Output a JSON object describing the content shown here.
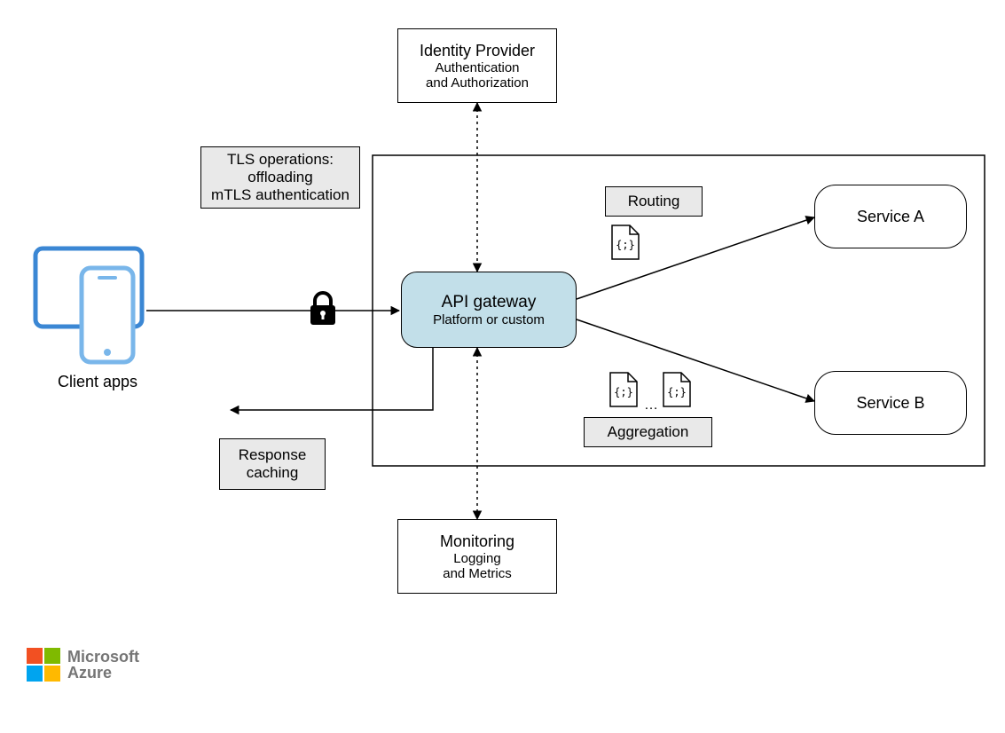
{
  "identity": {
    "title": "Identity Provider",
    "sub1": "Authentication",
    "sub2": "and Authorization"
  },
  "monitoring": {
    "title": "Monitoring",
    "sub1": "Logging",
    "sub2": "and Metrics"
  },
  "tls": {
    "l1": "TLS operations:",
    "l2": "offloading",
    "l3": "mTLS authentication"
  },
  "responseCaching": {
    "l1": "Response",
    "l2": "caching"
  },
  "routing": {
    "label": "Routing"
  },
  "aggregation": {
    "label": "Aggregation",
    "ellipsis": "…"
  },
  "gateway": {
    "title": "API gateway",
    "sub": "Platform or custom"
  },
  "serviceA": {
    "label": "Service A"
  },
  "serviceB": {
    "label": "Service B"
  },
  "clientApps": {
    "label": "Client apps"
  },
  "brand": {
    "l1": "Microsoft",
    "l2": "Azure"
  },
  "icons": {
    "lock": "lock-icon",
    "doc": "document-icon",
    "tablet": "tablet-icon",
    "phone": "phone-icon"
  },
  "palette": {
    "gatewayFill": "#c2dfe9",
    "grayFill": "#e9e9e9",
    "deviceBlue": "#3b87d4",
    "deviceLight": "#79b6ea"
  }
}
